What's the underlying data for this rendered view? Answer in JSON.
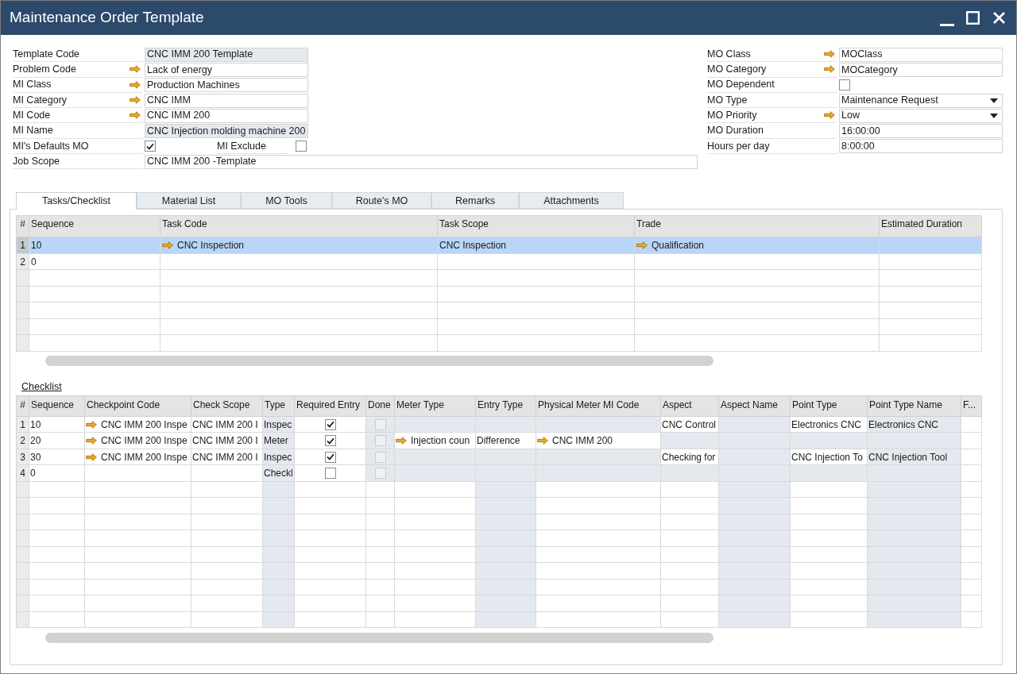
{
  "window": {
    "title": "Maintenance Order Template"
  },
  "header_left": {
    "fields": [
      {
        "kind": "text",
        "label": "Template Code",
        "value": "CNC IMM 200 Template",
        "link": false,
        "readonly": true
      },
      {
        "kind": "text",
        "label": "Problem Code",
        "value": "Lack of energy",
        "link": true,
        "readonly": false
      },
      {
        "kind": "text",
        "label": "MI Class",
        "value": "Production Machines",
        "link": true,
        "readonly": false
      },
      {
        "kind": "text",
        "label": "MI Category",
        "value": "CNC IMM",
        "link": true,
        "readonly": false
      },
      {
        "kind": "text",
        "label": "MI Code",
        "value": "CNC IMM 200",
        "link": true,
        "readonly": false
      },
      {
        "kind": "text",
        "label": "MI Name",
        "value": "CNC Injection molding machine 200",
        "link": false,
        "readonly": true
      },
      {
        "kind": "checkbox_pair",
        "items": [
          {
            "label": "MI's Defaults MO",
            "checked": true
          },
          {
            "label": "MI Exclude",
            "checked": false
          }
        ]
      },
      {
        "kind": "wide",
        "label": "Job Scope",
        "value": "CNC IMM 200 -Template",
        "link": false,
        "readonly": false
      }
    ]
  },
  "header_right": {
    "fields": [
      {
        "kind": "text",
        "label": "MO Class",
        "value": "MOClass",
        "link": true,
        "readonly": false
      },
      {
        "kind": "text",
        "label": "MO Category",
        "value": "MOCategory",
        "link": true,
        "readonly": false
      },
      {
        "kind": "checkbox",
        "label": "MO Dependent",
        "checked": false
      },
      {
        "kind": "dropdown",
        "label": "MO Type",
        "value": "Maintenance Request",
        "link": false,
        "readonly": false
      },
      {
        "kind": "dropdown",
        "label": "MO Priority",
        "value": "Low",
        "link": true,
        "readonly": false
      },
      {
        "kind": "text",
        "label": "MO Duration",
        "value": "16:00:00",
        "link": false,
        "readonly": false
      },
      {
        "kind": "text",
        "label": "Hours per day",
        "value": "8:00:00",
        "link": false,
        "readonly": false
      }
    ]
  },
  "tabs": [
    {
      "label": "Tasks/Checklist",
      "selected": true
    },
    {
      "label": "Material List",
      "selected": false
    },
    {
      "label": "MO Tools",
      "selected": false
    },
    {
      "label": "Route's MO",
      "selected": false
    },
    {
      "label": "Remarks",
      "selected": false
    },
    {
      "label": "Attachments",
      "selected": false
    }
  ],
  "tasks_table": {
    "columns": [
      {
        "label": "#",
        "kind": "number"
      },
      {
        "label": "Sequence",
        "kind": "text"
      },
      {
        "label": "Task Code",
        "kind": "text"
      },
      {
        "label": "Task Scope",
        "kind": "text"
      },
      {
        "label": "Trade",
        "kind": "text"
      },
      {
        "label": "Estimated Duration",
        "kind": "text"
      }
    ],
    "rows": [
      {
        "selected": true,
        "cells": [
          {
            "text": "1"
          },
          {
            "text": "10",
            "link": false
          },
          {
            "text": "CNC Inspection",
            "link": true
          },
          {
            "text": "CNC Inspection",
            "link": false
          },
          {
            "text": "Qualification",
            "link": true
          },
          {
            "link": false
          }
        ]
      },
      {
        "selected": false,
        "cells": [
          {
            "text": "2"
          },
          {
            "text": "0",
            "link": false
          },
          {
            "link": false
          },
          {
            "link": false
          },
          {
            "link": false
          },
          {
            "link": false
          }
        ]
      }
    ]
  },
  "checklist": {
    "title": "Checklist",
    "columns": [
      {
        "label": "#",
        "kind": "number",
        "disabled": true
      },
      {
        "label": "Sequence",
        "kind": "text",
        "disabled": false
      },
      {
        "label": "Checkpoint Code",
        "kind": "text",
        "disabled": false
      },
      {
        "label": "Check Scope",
        "kind": "text",
        "disabled": false
      },
      {
        "label": "Type",
        "kind": "text",
        "disabled": true
      },
      {
        "label": "Required Entry",
        "kind": "check",
        "disabled": false
      },
      {
        "label": "Done",
        "kind": "check",
        "disabled": false
      },
      {
        "label": "Meter Type",
        "kind": "text",
        "disabled": false
      },
      {
        "label": "Entry Type",
        "kind": "text",
        "disabled": true
      },
      {
        "label": "Physical Meter MI Code",
        "kind": "text",
        "disabled": false
      },
      {
        "label": "Aspect",
        "kind": "text",
        "disabled": false
      },
      {
        "label": "Aspect Name",
        "kind": "text",
        "disabled": true
      },
      {
        "label": "Point Type",
        "kind": "text",
        "disabled": false
      },
      {
        "label": "Point Type Name",
        "kind": "text",
        "disabled": true
      },
      {
        "label": "F...",
        "kind": "text",
        "disabled": false
      }
    ],
    "rows": [
      {
        "cells": [
          {
            "text": "1"
          },
          {
            "text": "10",
            "link": false,
            "disabled": false
          },
          {
            "text": "CNC IMM 200 Inspe",
            "link": true,
            "disabled": false
          },
          {
            "text": "CNC IMM 200 I",
            "link": false,
            "disabled": false
          },
          {
            "text": "Inspec",
            "link": false,
            "disabled": true
          },
          {
            "checked": true,
            "disabled": false
          },
          {
            "checked": false,
            "disabled": true
          },
          {
            "link": false,
            "disabled": true
          },
          {
            "link": false,
            "disabled": true
          },
          {
            "link": false,
            "disabled": true
          },
          {
            "text": "CNC Control",
            "link": false,
            "disabled": false
          },
          {
            "link": false,
            "disabled": true
          },
          {
            "text": "Electronics CNC",
            "link": false,
            "disabled": false
          },
          {
            "text": "Electronics CNC",
            "link": false,
            "disabled": true
          },
          {
            "link": false,
            "disabled": false
          }
        ]
      },
      {
        "cells": [
          {
            "text": "2"
          },
          {
            "text": "20",
            "link": false,
            "disabled": false
          },
          {
            "text": "CNC IMM 200 Inspe",
            "link": true,
            "disabled": false
          },
          {
            "text": "CNC IMM 200 I",
            "link": false,
            "disabled": false
          },
          {
            "text": "Meter",
            "link": false,
            "disabled": true
          },
          {
            "checked": true,
            "disabled": false
          },
          {
            "checked": false,
            "disabled": true
          },
          {
            "text": "Injection coun",
            "link": true,
            "disabled": false
          },
          {
            "text": "Difference",
            "link": false,
            "disabled": false
          },
          {
            "text": "CNC IMM 200",
            "link": true,
            "disabled": false
          },
          {
            "link": false,
            "disabled": true
          },
          {
            "link": false,
            "disabled": true
          },
          {
            "link": false,
            "disabled": true
          },
          {
            "link": false,
            "disabled": true
          },
          {
            "link": false,
            "disabled": false
          }
        ]
      },
      {
        "cells": [
          {
            "text": "3"
          },
          {
            "text": "30",
            "link": false,
            "disabled": false
          },
          {
            "text": "CNC IMM 200 Inspe",
            "link": true,
            "disabled": false
          },
          {
            "text": "CNC IMM 200 I",
            "link": false,
            "disabled": false
          },
          {
            "text": "Inspec",
            "link": false,
            "disabled": true
          },
          {
            "checked": true,
            "disabled": false
          },
          {
            "checked": false,
            "disabled": true
          },
          {
            "link": false,
            "disabled": true
          },
          {
            "link": false,
            "disabled": true
          },
          {
            "link": false,
            "disabled": true
          },
          {
            "text": "Checking for",
            "link": false,
            "disabled": false
          },
          {
            "link": false,
            "disabled": true
          },
          {
            "text": "CNC Injection To",
            "link": false,
            "disabled": false
          },
          {
            "text": "CNC Injection Tool",
            "link": false,
            "disabled": true
          },
          {
            "link": false,
            "disabled": false
          }
        ]
      },
      {
        "cells": [
          {
            "text": "4"
          },
          {
            "text": "0",
            "link": false,
            "disabled": false
          },
          {
            "link": false,
            "disabled": false
          },
          {
            "link": false,
            "disabled": false
          },
          {
            "text": "Checkl",
            "link": false,
            "disabled": true
          },
          {
            "checked": false,
            "disabled": false
          },
          {
            "checked": false,
            "disabled": true
          },
          {
            "link": false,
            "disabled": true
          },
          {
            "link": false,
            "disabled": true
          },
          {
            "link": false,
            "disabled": true
          },
          {
            "link": false,
            "disabled": true
          },
          {
            "link": false,
            "disabled": true
          },
          {
            "link": false,
            "disabled": true
          },
          {
            "link": false,
            "disabled": true
          },
          {
            "link": false,
            "disabled": false
          }
        ]
      }
    ]
  }
}
